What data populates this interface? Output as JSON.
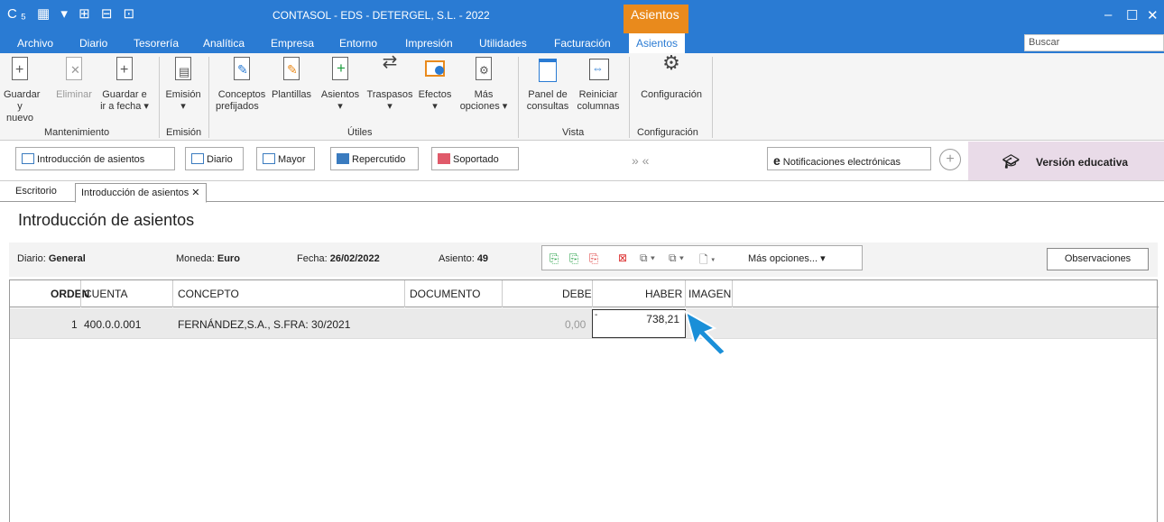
{
  "titlebar": {
    "title": "CONTASOL - EDS - DETERGEL, S.L. - 2022",
    "context_tab": "Asientos",
    "minimize": "–",
    "maximize": "☐",
    "close": "✕"
  },
  "menu": [
    "Archivo",
    "Diario",
    "Tesorería",
    "Analítica",
    "Empresa",
    "Entorno",
    "Impresión",
    "Utilidades",
    "Facturación",
    "Asientos"
  ],
  "search": {
    "placeholder": "Buscar"
  },
  "ribbon": {
    "mantenimiento": {
      "group": "Mantenimiento",
      "guardar_nuevo": [
        "Guardar",
        "y nuevo"
      ],
      "eliminar": "Eliminar",
      "guardar_fecha": [
        "Guardar e",
        "ir a fecha ▾"
      ]
    },
    "emision": {
      "group": "Emisión",
      "label": "Emisión",
      "arrow": "▾"
    },
    "utiles": {
      "group": "Útiles",
      "conceptos": [
        "Conceptos",
        "prefijados"
      ],
      "plantillas": "Plantillas",
      "asientos": "Asientos",
      "traspasos": "Traspasos",
      "efectos": "Efectos",
      "mas": [
        "Más",
        "opciones ▾"
      ],
      "arrow": "▾"
    },
    "vista": {
      "group": "Vista",
      "panel": [
        "Panel de",
        "consultas"
      ],
      "reiniciar": [
        "Reiniciar",
        "columnas"
      ]
    },
    "configuracion": {
      "group": "Configuración",
      "label": "Configuración"
    }
  },
  "quickbar": {
    "introduccion": "Introducción de asientos",
    "diario": "Diario",
    "mayor": "Mayor",
    "repercutido": "Repercutido",
    "soportado": "Soportado",
    "chevrons": "»  «",
    "notificaciones": "Notificaciones electrónicas",
    "version": "Versión educativa"
  },
  "tabs": {
    "escritorio": "Escritorio",
    "introduccion": "Introducción de asientos ✕"
  },
  "heading": "Introducción de asientos",
  "info": {
    "diario_label": "Diario:",
    "diario_value": "General",
    "moneda_label": "Moneda:",
    "moneda_value": "Euro",
    "fecha_label": "Fecha:",
    "fecha_value": "26/02/2022",
    "asiento_label": "Asiento:",
    "asiento_value": "49",
    "mas_opciones": "Más opciones... ▾",
    "observaciones": "Observaciones"
  },
  "grid": {
    "columns": {
      "orden": "ORDEN",
      "cuenta": "CUENTA",
      "concepto": "CONCEPTO",
      "documento": "DOCUMENTO",
      "debe": "DEBE",
      "haber": "HABER",
      "imagen": "IMAGEN"
    },
    "rows": [
      {
        "orden": "1",
        "cuenta": "400.0.0.001",
        "concepto": "FERNÁNDEZ,S.A., S.FRA: 30/2021",
        "documento": "",
        "debe": "0,00",
        "haber": "738,21"
      }
    ]
  },
  "colors": {
    "accent": "#2a7bd3",
    "context_tab": "#e98a1c",
    "cursor_arrow": "#1a8fd8",
    "edu_bg": "#e9dbe8"
  }
}
